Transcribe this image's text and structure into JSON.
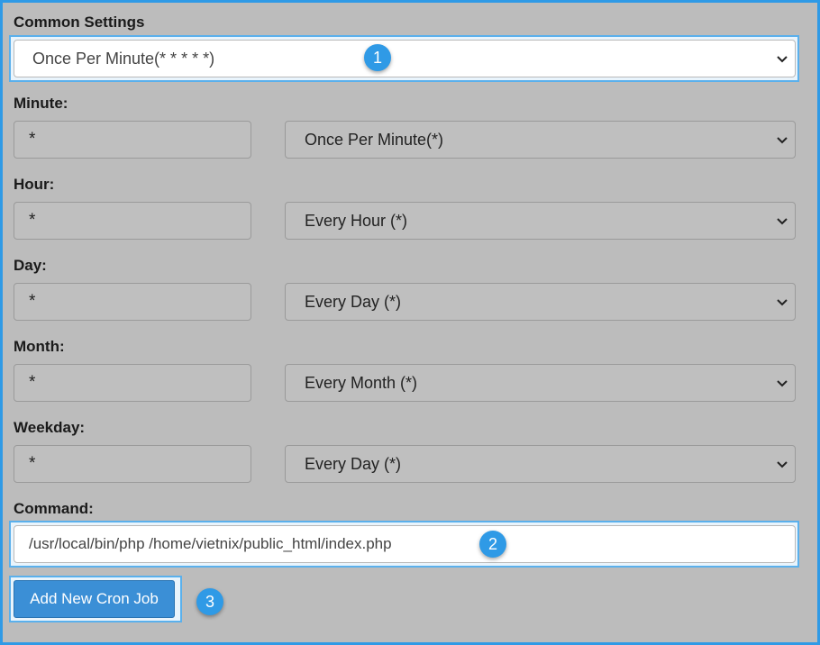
{
  "common_settings": {
    "label": "Common Settings",
    "value": "Once Per Minute(* * * * *)"
  },
  "minute": {
    "label": "Minute:",
    "value": "*",
    "select": "Once Per Minute(*)"
  },
  "hour": {
    "label": "Hour:",
    "value": "*",
    "select": "Every Hour (*)"
  },
  "day": {
    "label": "Day:",
    "value": "*",
    "select": "Every Day (*)"
  },
  "month": {
    "label": "Month:",
    "value": "*",
    "select": "Every Month (*)"
  },
  "weekday": {
    "label": "Weekday:",
    "value": "*",
    "select": "Every Day (*)"
  },
  "command": {
    "label": "Command:",
    "value": "/usr/local/bin/php /home/vietnix/public_html/index.php"
  },
  "submit": {
    "label": "Add New Cron Job"
  },
  "badges": {
    "one": "1",
    "two": "2",
    "three": "3"
  },
  "colors": {
    "accent": "#2f9ae6",
    "button": "#3b8fd6",
    "panel": "#bcbcbc"
  }
}
